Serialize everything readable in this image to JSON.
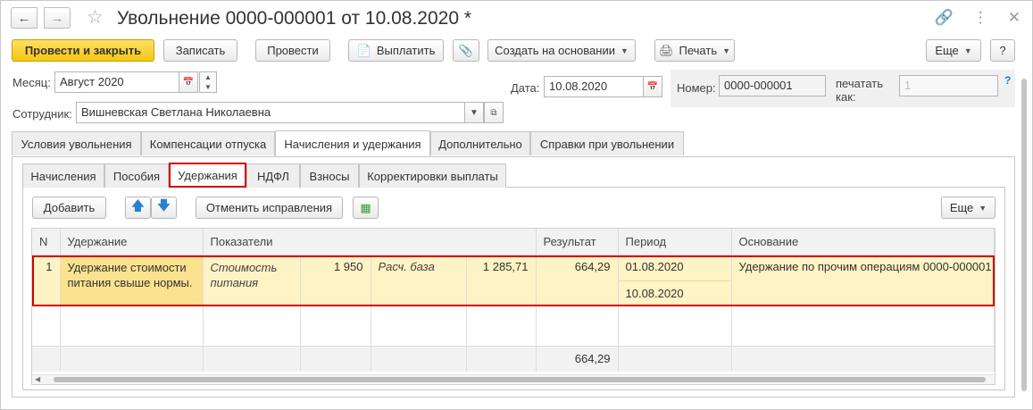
{
  "window": {
    "title": "Увольнение 0000-000001 от 10.08.2020 *",
    "icons": [
      "arrow-left-icon",
      "arrow-right-icon",
      "star-icon",
      "link-icon",
      "more-icon",
      "close-icon"
    ]
  },
  "toolbar": {
    "post_close": "Провести и закрыть",
    "save": "Записать",
    "post": "Провести",
    "pay": "Выплатить",
    "create_based": "Создать на основании",
    "print": "Печать",
    "more": "Еще",
    "help": "?"
  },
  "form": {
    "month_label": "Месяц:",
    "month_value": "Август 2020",
    "date_label": "Дата:",
    "date_value": "10.08.2020",
    "number_label": "Номер:",
    "number_value": "0000-000001",
    "print_as_label": "печатать как:",
    "print_as_placeholder": "1",
    "help_mark": "?",
    "employee_label": "Сотрудник:",
    "employee_value": "Вишневская Светлана Николаевна"
  },
  "tabs": [
    "Условия увольнения",
    "Компенсации отпуска",
    "Начисления и удержания",
    "Дополнительно",
    "Справки при увольнении"
  ],
  "subtabs": [
    "Начисления",
    "Пособия",
    "Удержания",
    "НДФЛ",
    "Взносы",
    "Корректировки выплаты"
  ],
  "table_toolbar": {
    "add": "Добавить",
    "cancel_corrections": "Отменить исправления",
    "more": "Еще"
  },
  "table": {
    "headers": [
      "N",
      "Удержание",
      "Показатели",
      "Результат",
      "Период",
      "Основание"
    ],
    "rows": [
      {
        "n": "1",
        "deduction": "Удержание стоимости питания свыше нормы.",
        "indicator1_name": "Стоимость питания",
        "indicator1_value": "1 950",
        "indicator2_name": "Расч. база",
        "indicator2_value": "1 285,71",
        "result": "664,29",
        "period_start": "01.08.2020",
        "period_end": "10.08.2020",
        "basis": "Удержание по прочим операциям 0000-000001"
      }
    ],
    "total_result": "664,29"
  },
  "colors": {
    "primary_button": "#f5c612",
    "selected_row": "#fdf3c4",
    "selected_cell": "#fbe28f",
    "highlight_border": "#d10000"
  }
}
